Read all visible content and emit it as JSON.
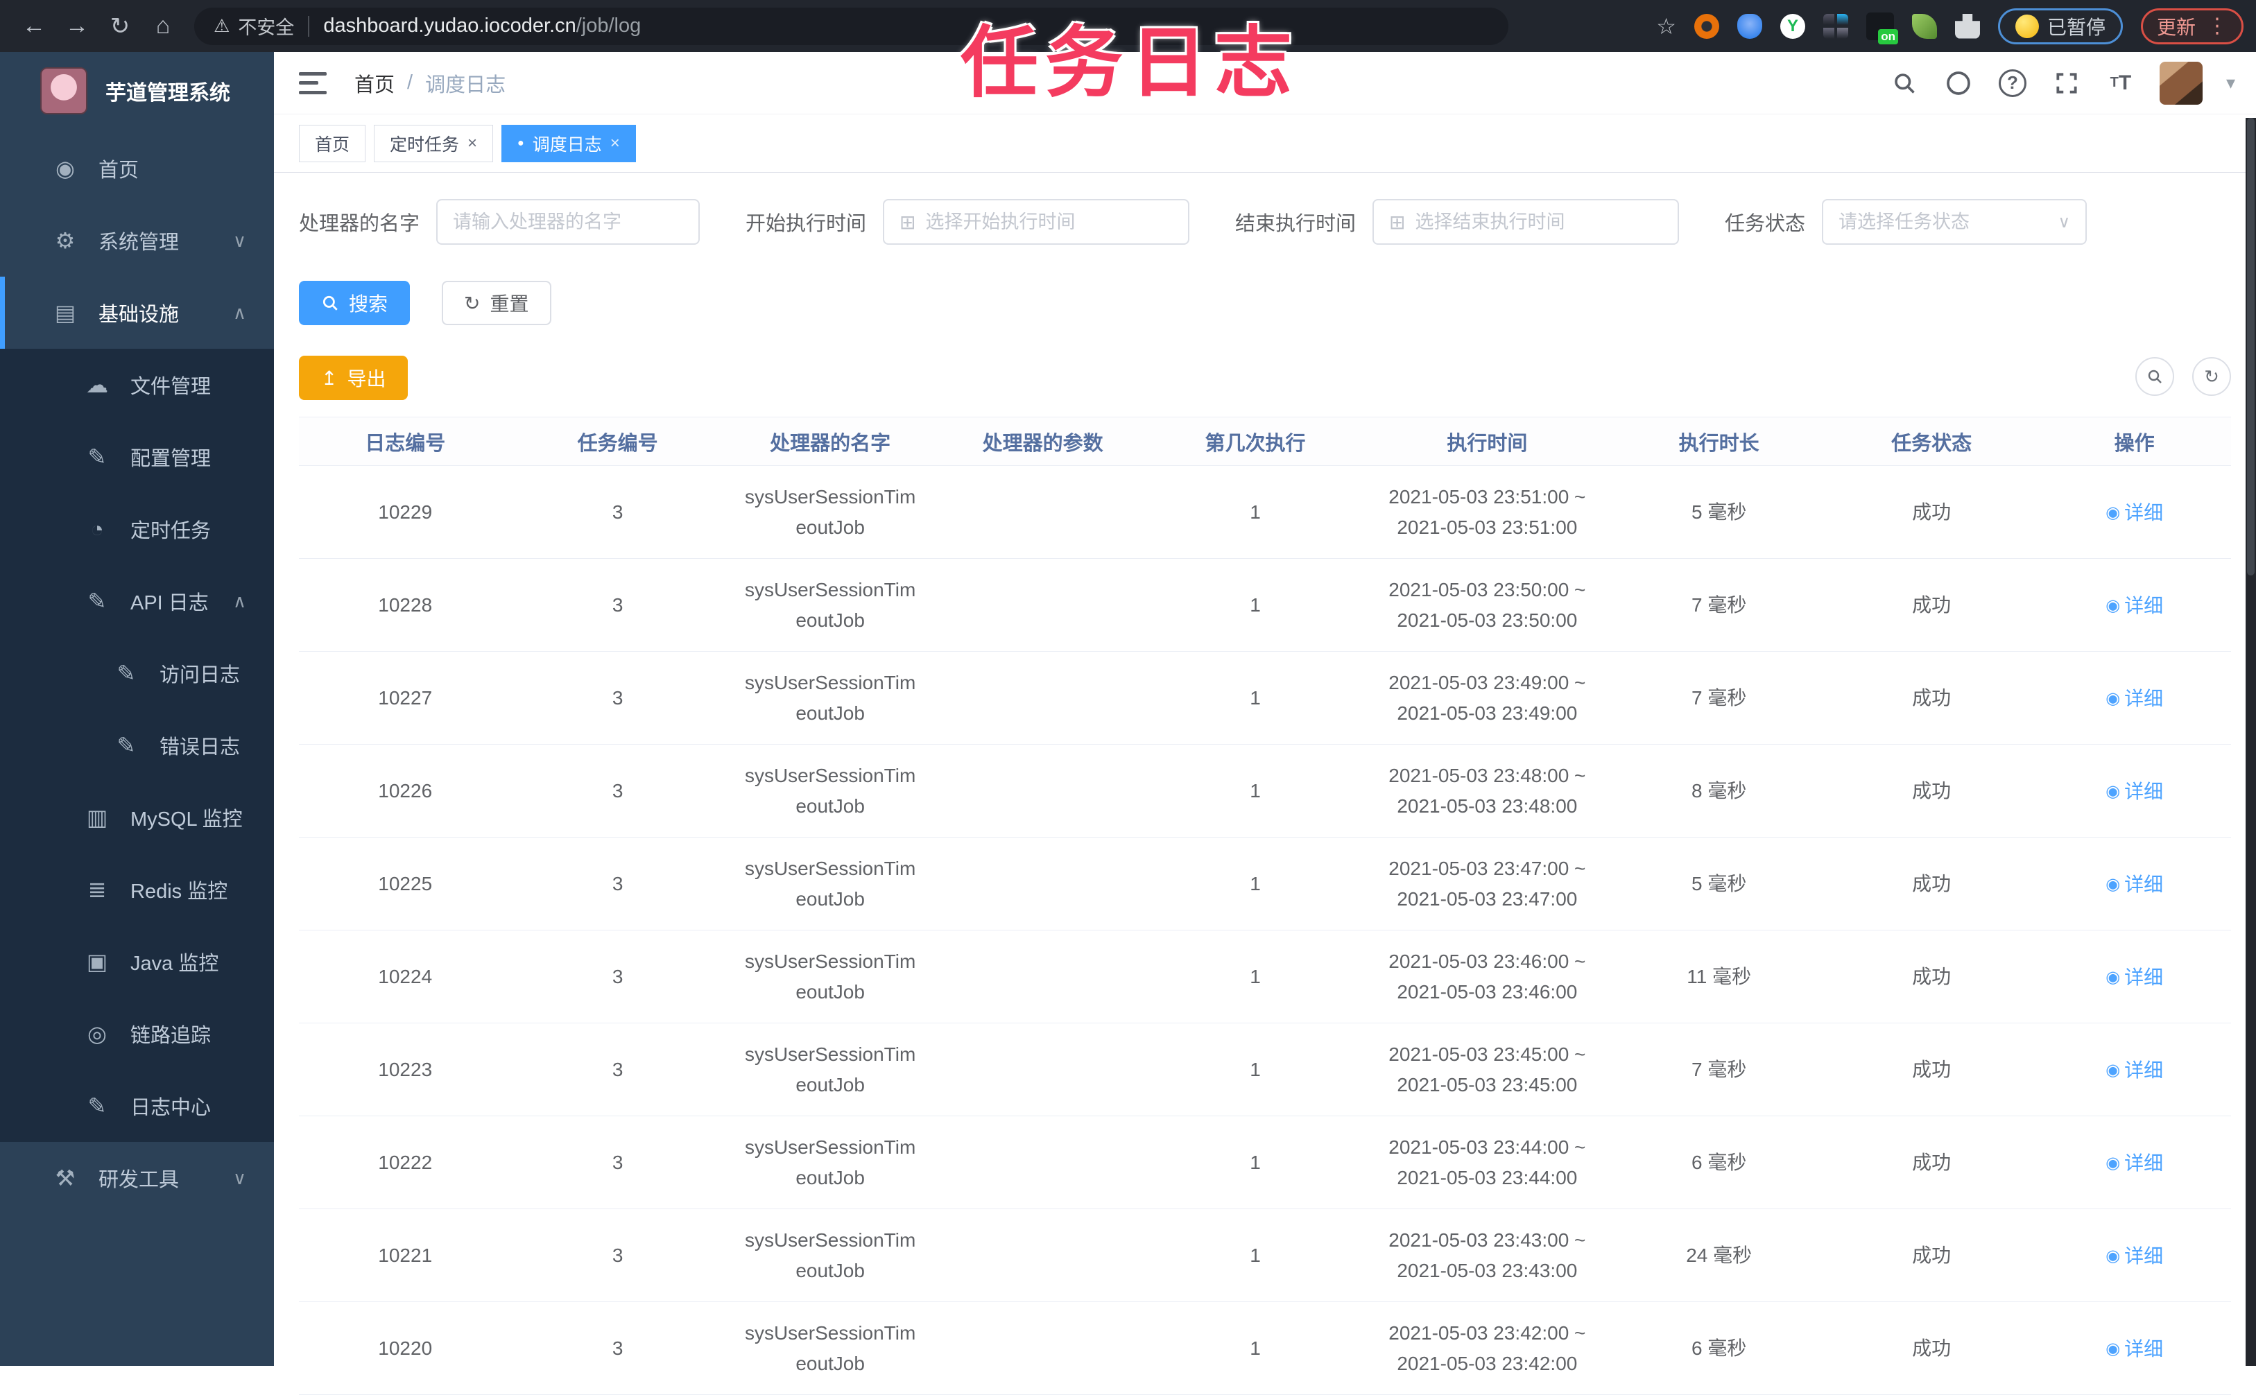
{
  "colors": {
    "primary": "#409eff",
    "warning": "#f5a60b",
    "watermark_pink": "#f43b5f",
    "sidebar_bg": "#2c4157",
    "submenu_bg": "#1c2c3f",
    "table_header_text": "#546fa0"
  },
  "watermark": "任务日志",
  "browser": {
    "back_glyph": "←",
    "forward_glyph": "→",
    "reload_glyph": "↻",
    "home_glyph": "⌂",
    "warning_glyph": "⚠",
    "security_label": "不安全",
    "url_host": "dashboard.yudao.iocoder.cn",
    "url_path": "/job/log",
    "star_glyph": "☆",
    "ext_y_letter": "Y",
    "paused_label": "已暂停",
    "update_label": "更新",
    "kebab_glyph": "⋮"
  },
  "sidebar": {
    "title": "芋道管理系统",
    "items": [
      {
        "label": "首页",
        "icon": "dashboard-icon",
        "glyph": "◉",
        "level": "1",
        "sub": "",
        "active": "",
        "chev": ""
      },
      {
        "label": "系统管理",
        "icon": "gear-icon",
        "glyph": "⚙",
        "level": "1",
        "sub": "",
        "active": "",
        "chev": "∨"
      },
      {
        "label": "基础设施",
        "icon": "infrastructure-icon",
        "glyph": "▤",
        "level": "1",
        "sub": "",
        "active": "1",
        "chev": "∧"
      },
      {
        "label": "文件管理",
        "icon": "file-upload-icon",
        "glyph": "☁",
        "level": "2",
        "sub": "1",
        "active": "",
        "chev": ""
      },
      {
        "label": "配置管理",
        "icon": "config-edit-icon",
        "glyph": "✎",
        "level": "2",
        "sub": "1",
        "active": "",
        "chev": ""
      },
      {
        "label": "定时任务",
        "icon": "timer-icon",
        "glyph": "◔",
        "level": "2",
        "sub": "1",
        "active": "",
        "chev": ""
      },
      {
        "label": "API 日志",
        "icon": "api-log-icon",
        "glyph": "✎",
        "level": "2",
        "sub": "1",
        "active": "",
        "chev": "∧"
      },
      {
        "label": "访问日志",
        "icon": "access-log-icon",
        "glyph": "✎",
        "level": "3",
        "sub": "1",
        "active": "",
        "chev": ""
      },
      {
        "label": "错误日志",
        "icon": "error-log-icon",
        "glyph": "✎",
        "level": "3",
        "sub": "1",
        "active": "",
        "chev": ""
      },
      {
        "label": "MySQL 监控",
        "icon": "mysql-monitor-icon",
        "glyph": "▥",
        "level": "2",
        "sub": "1",
        "active": "",
        "chev": ""
      },
      {
        "label": "Redis 监控",
        "icon": "redis-monitor-icon",
        "glyph": "≣",
        "level": "2",
        "sub": "1",
        "active": "",
        "chev": ""
      },
      {
        "label": "Java 监控",
        "icon": "java-monitor-icon",
        "glyph": "▣",
        "level": "2",
        "sub": "1",
        "active": "",
        "chev": ""
      },
      {
        "label": "链路追踪",
        "icon": "trace-eye-icon",
        "glyph": "◎",
        "level": "2",
        "sub": "1",
        "active": "",
        "chev": ""
      },
      {
        "label": "日志中心",
        "icon": "log-center-icon",
        "glyph": "✎",
        "level": "2",
        "sub": "1",
        "active": "",
        "chev": ""
      },
      {
        "label": "研发工具",
        "icon": "devtools-icon",
        "glyph": "⚒",
        "level": "1",
        "sub": "",
        "active": "",
        "chev": "∨"
      }
    ]
  },
  "header": {
    "breadcrumb_home": "首页",
    "breadcrumb_sep": "/",
    "breadcrumb_current": "调度日志",
    "font_size_big": "T",
    "font_size_small": "T",
    "caret_glyph": "▾",
    "question_glyph": "?"
  },
  "tabs": [
    {
      "label": "首页",
      "dot": "",
      "close": "",
      "active": ""
    },
    {
      "label": "定时任务",
      "dot": "",
      "close": "×",
      "active": ""
    },
    {
      "label": "调度日志",
      "dot": "●",
      "close": "×",
      "active": "1"
    }
  ],
  "filters": [
    {
      "label": "处理器的名字",
      "placeholder": "请输入处理器的名字",
      "type": "text",
      "prefix": "",
      "suffix": ""
    },
    {
      "label": "开始执行时间",
      "placeholder": "选择开始执行时间",
      "type": "date",
      "prefix": "⊞",
      "suffix": ""
    },
    {
      "label": "结束执行时间",
      "placeholder": "选择结束执行时间",
      "type": "date",
      "prefix": "⊞",
      "suffix": ""
    },
    {
      "label": "任务状态",
      "placeholder": "请选择任务状态",
      "type": "select",
      "prefix": "",
      "suffix": "∨"
    }
  ],
  "toolbar": {
    "search_label": "搜索",
    "reset_label": "重置",
    "export_label": "导出",
    "reset_glyph": "↻",
    "export_glyph": "↥",
    "refresh_glyph": "↻"
  },
  "table": {
    "columns": [
      "日志编号",
      "任务编号",
      "处理器的名字",
      "处理器的参数",
      "第几次执行",
      "执行时间",
      "执行时长",
      "任务状态",
      "操作"
    ],
    "action_eye_glyph": "◉",
    "rows": [
      {
        "id": "10229",
        "job": "3",
        "handler1": "sysUserSessionTim",
        "handler2": "eoutJob",
        "param": "",
        "count": "1",
        "time1": "2021-05-03 23:51:00 ~",
        "time2": "2021-05-03 23:51:00",
        "duration": "5 毫秒",
        "status": "成功",
        "action": "详细"
      },
      {
        "id": "10228",
        "job": "3",
        "handler1": "sysUserSessionTim",
        "handler2": "eoutJob",
        "param": "",
        "count": "1",
        "time1": "2021-05-03 23:50:00 ~",
        "time2": "2021-05-03 23:50:00",
        "duration": "7 毫秒",
        "status": "成功",
        "action": "详细"
      },
      {
        "id": "10227",
        "job": "3",
        "handler1": "sysUserSessionTim",
        "handler2": "eoutJob",
        "param": "",
        "count": "1",
        "time1": "2021-05-03 23:49:00 ~",
        "time2": "2021-05-03 23:49:00",
        "duration": "7 毫秒",
        "status": "成功",
        "action": "详细"
      },
      {
        "id": "10226",
        "job": "3",
        "handler1": "sysUserSessionTim",
        "handler2": "eoutJob",
        "param": "",
        "count": "1",
        "time1": "2021-05-03 23:48:00 ~",
        "time2": "2021-05-03 23:48:00",
        "duration": "8 毫秒",
        "status": "成功",
        "action": "详细"
      },
      {
        "id": "10225",
        "job": "3",
        "handler1": "sysUserSessionTim",
        "handler2": "eoutJob",
        "param": "",
        "count": "1",
        "time1": "2021-05-03 23:47:00 ~",
        "time2": "2021-05-03 23:47:00",
        "duration": "5 毫秒",
        "status": "成功",
        "action": "详细"
      },
      {
        "id": "10224",
        "job": "3",
        "handler1": "sysUserSessionTim",
        "handler2": "eoutJob",
        "param": "",
        "count": "1",
        "time1": "2021-05-03 23:46:00 ~",
        "time2": "2021-05-03 23:46:00",
        "duration": "11 毫秒",
        "status": "成功",
        "action": "详细"
      },
      {
        "id": "10223",
        "job": "3",
        "handler1": "sysUserSessionTim",
        "handler2": "eoutJob",
        "param": "",
        "count": "1",
        "time1": "2021-05-03 23:45:00 ~",
        "time2": "2021-05-03 23:45:00",
        "duration": "7 毫秒",
        "status": "成功",
        "action": "详细"
      },
      {
        "id": "10222",
        "job": "3",
        "handler1": "sysUserSessionTim",
        "handler2": "eoutJob",
        "param": "",
        "count": "1",
        "time1": "2021-05-03 23:44:00 ~",
        "time2": "2021-05-03 23:44:00",
        "duration": "6 毫秒",
        "status": "成功",
        "action": "详细"
      },
      {
        "id": "10221",
        "job": "3",
        "handler1": "sysUserSessionTim",
        "handler2": "eoutJob",
        "param": "",
        "count": "1",
        "time1": "2021-05-03 23:43:00 ~",
        "time2": "2021-05-03 23:43:00",
        "duration": "24 毫秒",
        "status": "成功",
        "action": "详细"
      },
      {
        "id": "10220",
        "job": "3",
        "handler1": "sysUserSessionTim",
        "handler2": "eoutJob",
        "param": "",
        "count": "1",
        "time1": "2021-05-03 23:42:00 ~",
        "time2": "2021-05-03 23:42:00",
        "duration": "6 毫秒",
        "status": "成功",
        "action": "详细"
      }
    ]
  }
}
